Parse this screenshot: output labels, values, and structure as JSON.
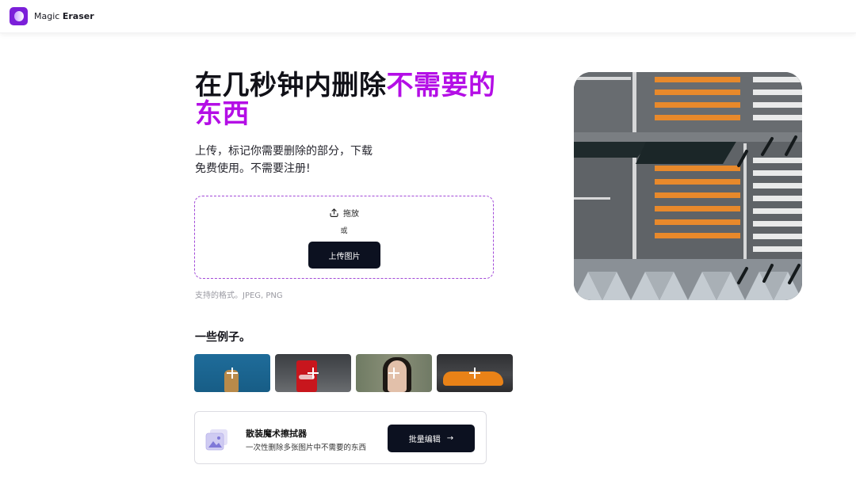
{
  "header": {
    "brand_prefix": "Magic",
    "brand_bold": "Eraser"
  },
  "hero": {
    "title_main": "在几秒钟内删除",
    "title_accent": "不需要的东西",
    "subtitle_line1": "上传，标记你需要删除的部分，下载",
    "subtitle_line2": "免费使用。不需要注册!"
  },
  "upload": {
    "drag_label": "拖放",
    "or_label": "或",
    "button_label": "上传图片",
    "formats_text": "支持的格式。JPEG, PNG"
  },
  "examples": {
    "title": "一些例子。",
    "items": [
      {
        "subject": "dog-on-blue"
      },
      {
        "subject": "coca-cola-can"
      },
      {
        "subject": "woman-portrait"
      },
      {
        "subject": "orange-sports-car"
      }
    ]
  },
  "batch": {
    "title": "散装魔术擦拭器",
    "description": "一次性删除多张图片中不需要的东西",
    "button_label": "批量编辑",
    "button_arrow": "→"
  },
  "colors": {
    "accent": "#b40ee6",
    "brand": "#7b1fd9",
    "button_dark": "#0c1120",
    "crosswalk_orange": "#e8892b"
  }
}
